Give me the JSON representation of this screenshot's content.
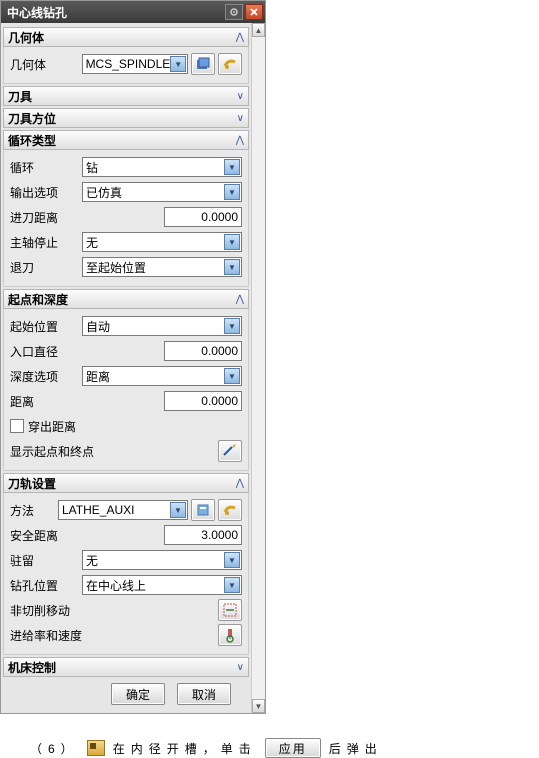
{
  "title": "中心线钻孔",
  "sections": {
    "geometry": {
      "title": "几何体",
      "label": "几何体",
      "value": "MCS_SPINDLE"
    },
    "tool": {
      "title": "刀具"
    },
    "toolAxis": {
      "title": "刀具方位"
    },
    "cycleType": {
      "title": "循环类型",
      "cycle": {
        "label": "循环",
        "value": "钻"
      },
      "output": {
        "label": "输出选项",
        "value": "已仿真"
      },
      "engage": {
        "label": "进刀距离",
        "value": "0.0000"
      },
      "spindle": {
        "label": "主轴停止",
        "value": "无"
      },
      "retract": {
        "label": "退刀",
        "value": "至起始位置"
      }
    },
    "startDepth": {
      "title": "起点和深度",
      "startPos": {
        "label": "起始位置",
        "value": "自动"
      },
      "inDia": {
        "label": "入口直径",
        "value": "0.0000"
      },
      "depthOpt": {
        "label": "深度选项",
        "value": "距离"
      },
      "dist": {
        "label": "距离",
        "value": "0.0000"
      },
      "through": {
        "label": "穿出距离"
      },
      "showPts": {
        "label": "显示起点和终点"
      }
    },
    "pathSettings": {
      "title": "刀轨设置",
      "method": {
        "label": "方法",
        "value": "LATHE_AUXI"
      },
      "safeDist": {
        "label": "安全距离",
        "value": "3.0000"
      },
      "dwell": {
        "label": "驻留",
        "value": "无"
      },
      "drillPos": {
        "label": "钻孔位置",
        "value": "在中心线上"
      },
      "nonCut": {
        "label": "非切削移动"
      },
      "feed": {
        "label": "进给率和速度"
      }
    },
    "machine": {
      "title": "机床控制"
    }
  },
  "footer": {
    "ok": "确定",
    "cancel": "取消"
  },
  "caption": {
    "num": "（6）",
    "text1": "在内径开槽，单击",
    "btn": "应用",
    "text2": "后弹出"
  }
}
